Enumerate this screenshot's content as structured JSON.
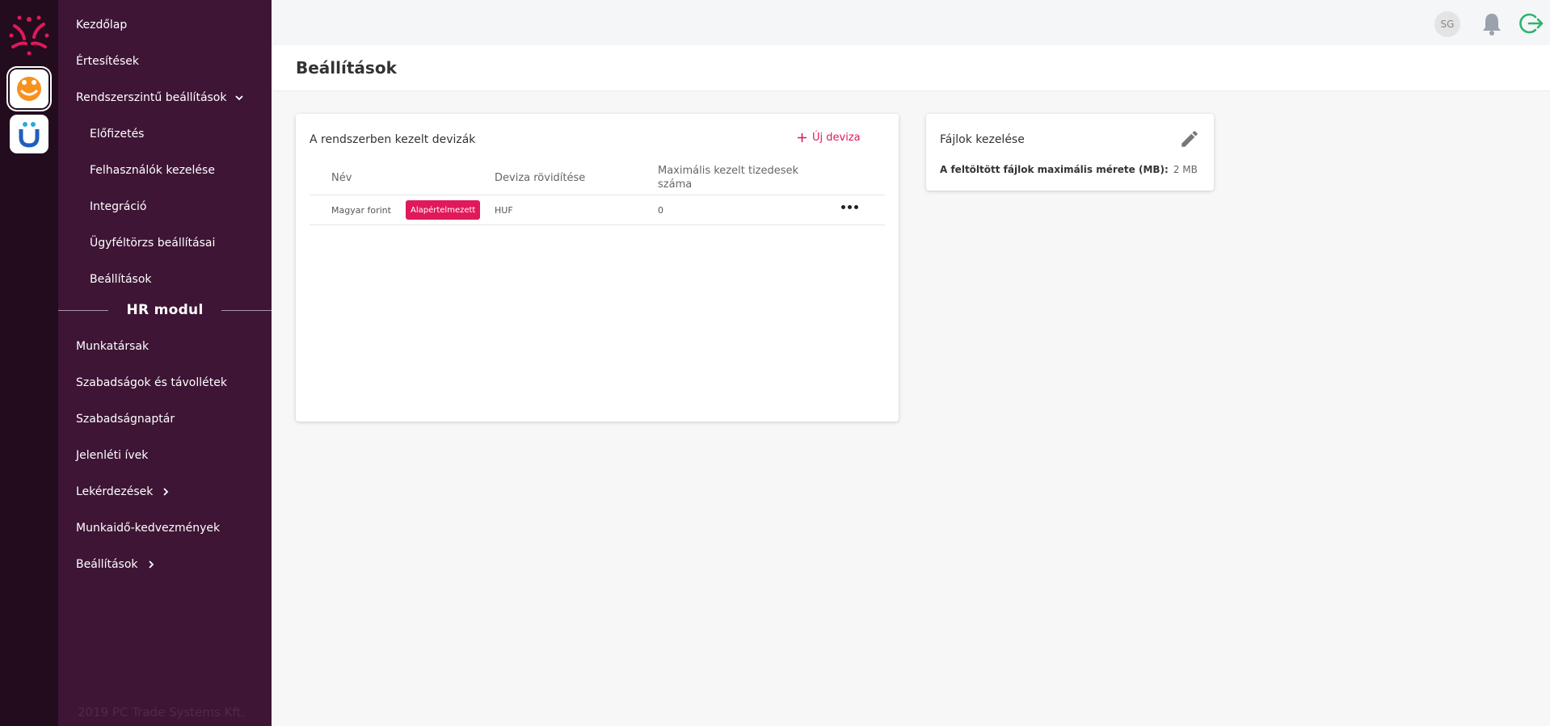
{
  "sidebar": {
    "items": [
      {
        "label": "Kezdőlap"
      },
      {
        "label": "Értesítések"
      },
      {
        "label": "Rendszerszintű beállítások"
      },
      {
        "label": "Előfizetés"
      },
      {
        "label": "Felhasználók kezelése"
      },
      {
        "label": "Integráció"
      },
      {
        "label": "Ügyféltörzs beállításai"
      },
      {
        "label": "Beállítások"
      }
    ],
    "section_label": "HR modul",
    "hr_items": [
      {
        "label": "Munkatársak"
      },
      {
        "label": "Szabadságok és távollétek"
      },
      {
        "label": "Szabadságnaptár"
      },
      {
        "label": "Jelenléti ívek"
      },
      {
        "label": "Lekérdezések"
      },
      {
        "label": "Munkaidő-kedvezmények"
      },
      {
        "label": "Beállítások"
      }
    ],
    "copyright": "2019 PC Trade Systems Kft."
  },
  "topbar": {
    "avatar_initials": "SG",
    "icons": [
      "bell-icon",
      "logout-icon"
    ]
  },
  "page": {
    "title": "Beállítások"
  },
  "currency_card": {
    "title": "A rendszerben kezelt devizák",
    "new_button_label": "Új deviza",
    "columns": [
      "Név",
      "Deviza rövidítése",
      "Maximális kezelt tizedesek száma"
    ],
    "rows": [
      {
        "name": "Magyar forint",
        "badge": "Alapértelmezett",
        "code": "HUF",
        "decimals": "0"
      }
    ]
  },
  "files_card": {
    "title": "Fájlok kezelése",
    "label": "A feltöltött fájlok maximális mérete (MB):",
    "value": "2 MB"
  },
  "colors": {
    "rail": "#220c1d",
    "sidebar": "#3e1535",
    "accent": "#e0195a",
    "logout": "#2fb36b"
  }
}
